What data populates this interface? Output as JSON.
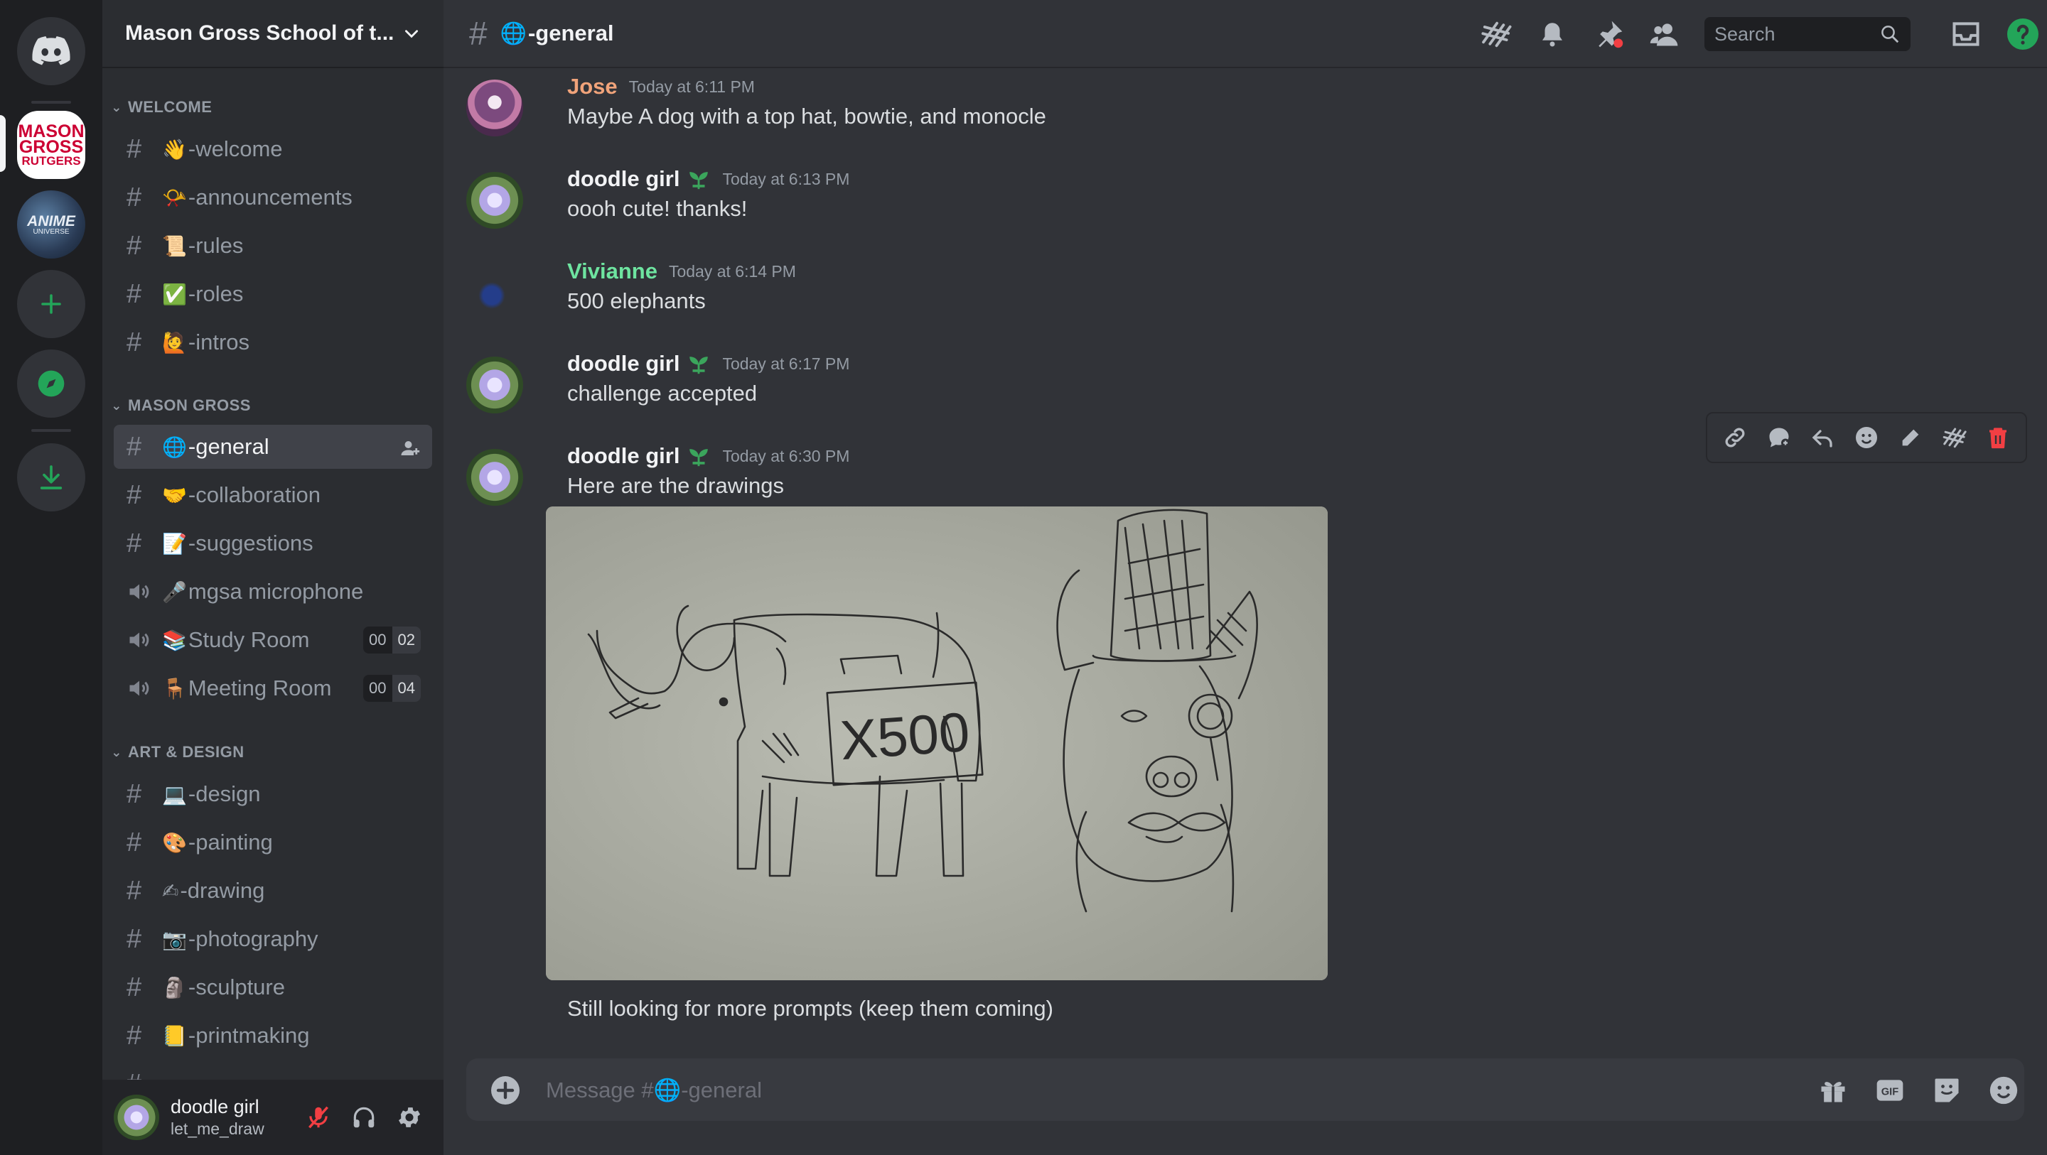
{
  "guild": {
    "name": "Mason Gross School of t..."
  },
  "rail": {
    "servers": [
      {
        "name": "Mason Gross Rutgers",
        "logo_text": [
          "MASON",
          "GROSS",
          "RUTGERS"
        ]
      },
      {
        "name": "Anime Universe",
        "logo_text": [
          "ANIME",
          "UNIVERSE"
        ]
      }
    ],
    "icons": [
      "discord-home-icon",
      "add-server-icon",
      "explore-icon",
      "download-icon"
    ]
  },
  "categories": [
    {
      "label": "WELCOME"
    },
    {
      "label": "MASON GROSS"
    },
    {
      "label": "ART & DESIGN"
    }
  ],
  "channels": [
    {
      "name": "-welcome",
      "emoji": "👋",
      "type": "text"
    },
    {
      "name": "-announcements",
      "emoji": "📯",
      "type": "text"
    },
    {
      "name": "-rules",
      "emoji": "📜",
      "type": "text"
    },
    {
      "name": "-roles",
      "emoji": "✅",
      "type": "text"
    },
    {
      "name": "-intros",
      "emoji": "🙋",
      "type": "text"
    },
    {
      "name": "-general",
      "emoji": "🌐",
      "type": "text",
      "active": true
    },
    {
      "name": "-collaboration",
      "emoji": "🤝",
      "type": "text"
    },
    {
      "name": "-suggestions",
      "emoji": "📝",
      "type": "text"
    },
    {
      "name": "mgsa microphone",
      "emoji": "🎤",
      "type": "voice"
    },
    {
      "name": "Study Room",
      "emoji": "📚",
      "type": "voice",
      "counts": [
        "00",
        "02"
      ]
    },
    {
      "name": "Meeting Room",
      "emoji": "🪑",
      "type": "voice",
      "counts": [
        "00",
        "04"
      ]
    },
    {
      "name": "-design",
      "emoji": "💻",
      "type": "text"
    },
    {
      "name": "-painting",
      "emoji": "🎨",
      "type": "text"
    },
    {
      "name": "-drawing",
      "emoji": "✍",
      "type": "text"
    },
    {
      "name": "-photography",
      "emoji": "📷",
      "type": "text"
    },
    {
      "name": "-sculpture",
      "emoji": "🗿",
      "type": "text"
    },
    {
      "name": "-printmaking",
      "emoji": "📒",
      "type": "text"
    }
  ],
  "user": {
    "display_name": "doodle girl",
    "username": "let_me_draw"
  },
  "topbar": {
    "channel_emoji": "🌐",
    "channel_name": "-general",
    "search_placeholder": "Search"
  },
  "messages": [
    {
      "author": "Jose",
      "author_color": "#f0a37a",
      "time": "Today at 6:11 PM",
      "text": "Maybe A dog with a top hat, bowtie, and monocle"
    },
    {
      "author": "doodle girl",
      "author_color": "#f2f3f5",
      "time": "Today at 6:13 PM",
      "text": "oooh cute! thanks!"
    },
    {
      "author": "Vivianne",
      "author_color": "#6ee4a0",
      "time": "Today at 6:14 PM",
      "text": "500 elephants"
    },
    {
      "author": "doodle girl",
      "author_color": "#f2f3f5",
      "time": "Today at 6:17 PM",
      "text": "challenge accepted"
    },
    {
      "author": "doodle girl",
      "author_color": "#f2f3f5",
      "time": "Today at 6:30 PM",
      "text": "Here are the drawings"
    }
  ],
  "attachment": {
    "drawing_text": "X500"
  },
  "followup_text": "Still looking for more prompts (keep them coming)",
  "composer": {
    "placeholder": "Message #🌐-general"
  },
  "colors": {
    "accent_green": "#23a559",
    "danger": "#f23f43",
    "bg_main": "#313338",
    "bg_sidebar": "#2b2d31",
    "bg_rail": "#1e1f22"
  }
}
